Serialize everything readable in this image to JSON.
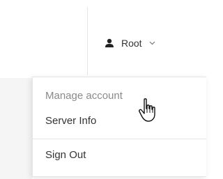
{
  "user_menu": {
    "username": "Root",
    "icon": "user-icon",
    "chevron": "chevron-down-icon"
  },
  "dropdown": {
    "items": [
      {
        "label": "Manage account",
        "state": "hover"
      },
      {
        "label": "Server Info"
      },
      {
        "label": "Sign Out"
      }
    ]
  },
  "cursor": {
    "icon": "hand-pointer-icon"
  }
}
